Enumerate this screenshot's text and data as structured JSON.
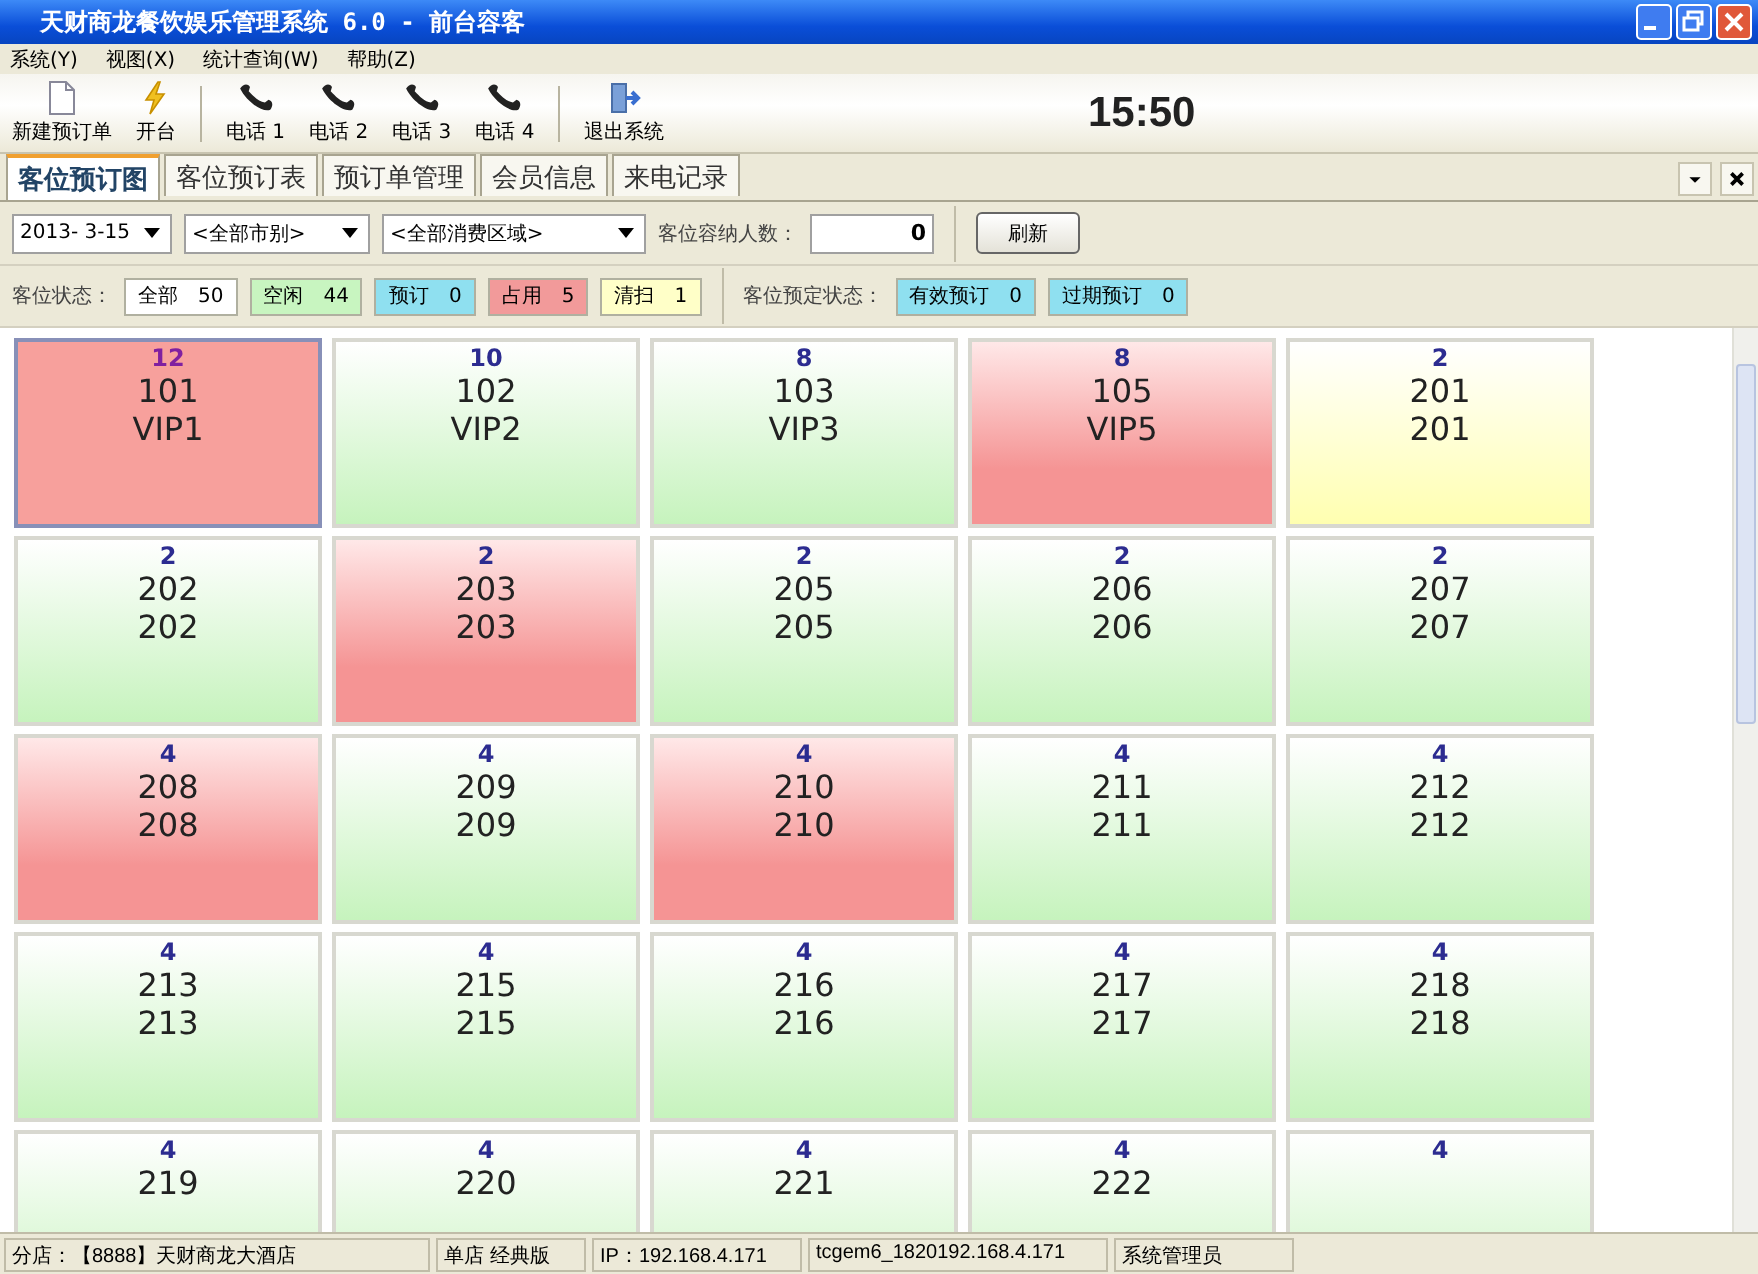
{
  "window": {
    "title": "天财商龙餐饮娱乐管理系统 6.0 - 前台容客"
  },
  "menu": [
    "系统(Y)",
    "视图(X)",
    "统计查询(W)",
    "帮助(Z)"
  ],
  "toolbar": [
    {
      "kind": "new",
      "label": "新建预订单"
    },
    {
      "kind": "open",
      "label": "开台"
    },
    {
      "kind": "separator"
    },
    {
      "kind": "phone",
      "label": "电话 1"
    },
    {
      "kind": "phone",
      "label": "电话 2"
    },
    {
      "kind": "phone",
      "label": "电话 3"
    },
    {
      "kind": "phone",
      "label": "电话 4"
    },
    {
      "kind": "separator"
    },
    {
      "kind": "exit",
      "label": "退出系统"
    }
  ],
  "clock": "15:50",
  "tabs": [
    {
      "label": "客位预订图",
      "selected": true
    },
    {
      "label": "客位预订表",
      "selected": false
    },
    {
      "label": "预订单管理",
      "selected": false
    },
    {
      "label": "会员信息",
      "selected": false
    },
    {
      "label": "来电记录",
      "selected": false
    }
  ],
  "filters": {
    "date": "2013- 3-15",
    "market": "<全部市别>",
    "area": "<全部消费区域>",
    "capacity_label": "客位容纳人数：",
    "capacity": "0",
    "refresh": "刷新"
  },
  "status_label": "客位状态：",
  "status_chips": [
    {
      "label": "全部",
      "count": "50",
      "color": "#ffffff"
    },
    {
      "label": "空闲",
      "count": "44",
      "color": "#c8f5c0"
    },
    {
      "label": "预订",
      "count": "0",
      "color": "#8fe0f0"
    },
    {
      "label": "占用",
      "count": "5",
      "color": "#f29a9a"
    },
    {
      "label": "清扫",
      "count": "1",
      "color": "#ffffc8"
    }
  ],
  "booking_label": "客位预定状态：",
  "booking_chips": [
    {
      "label": "有效预订",
      "count": "0",
      "color": "#8fe0f0"
    },
    {
      "label": "过期预订",
      "count": "0",
      "color": "#8fe0f0"
    }
  ],
  "tiles": [
    {
      "capacity": "12",
      "code": "101",
      "name": "VIP1",
      "kind": "occupied",
      "selected": true
    },
    {
      "capacity": "10",
      "code": "102",
      "name": "VIP2",
      "kind": "free",
      "selected": false
    },
    {
      "capacity": "8",
      "code": "103",
      "name": "VIP3",
      "kind": "free",
      "selected": false
    },
    {
      "capacity": "8",
      "code": "105",
      "name": "VIP5",
      "kind": "occupied",
      "selected": false
    },
    {
      "capacity": "2",
      "code": "201",
      "name": "201",
      "kind": "cleaning",
      "selected": false
    },
    {
      "capacity": "2",
      "code": "202",
      "name": "202",
      "kind": "free",
      "selected": false
    },
    {
      "capacity": "2",
      "code": "203",
      "name": "203",
      "kind": "occupied",
      "selected": false
    },
    {
      "capacity": "2",
      "code": "205",
      "name": "205",
      "kind": "free",
      "selected": false
    },
    {
      "capacity": "2",
      "code": "206",
      "name": "206",
      "kind": "free",
      "selected": false
    },
    {
      "capacity": "2",
      "code": "207",
      "name": "207",
      "kind": "free",
      "selected": false
    },
    {
      "capacity": "4",
      "code": "208",
      "name": "208",
      "kind": "occupied",
      "selected": false
    },
    {
      "capacity": "4",
      "code": "209",
      "name": "209",
      "kind": "free",
      "selected": false
    },
    {
      "capacity": "4",
      "code": "210",
      "name": "210",
      "kind": "occupied",
      "selected": false
    },
    {
      "capacity": "4",
      "code": "211",
      "name": "211",
      "kind": "free",
      "selected": false
    },
    {
      "capacity": "4",
      "code": "212",
      "name": "212",
      "kind": "free",
      "selected": false
    },
    {
      "capacity": "4",
      "code": "213",
      "name": "213",
      "kind": "free",
      "selected": false
    },
    {
      "capacity": "4",
      "code": "215",
      "name": "215",
      "kind": "free",
      "selected": false
    },
    {
      "capacity": "4",
      "code": "216",
      "name": "216",
      "kind": "free",
      "selected": false
    },
    {
      "capacity": "4",
      "code": "217",
      "name": "217",
      "kind": "free",
      "selected": false
    },
    {
      "capacity": "4",
      "code": "218",
      "name": "218",
      "kind": "free",
      "selected": false
    },
    {
      "capacity": "4",
      "code": "219",
      "kind": "free",
      "selected": false
    },
    {
      "capacity": "4",
      "code": "220",
      "kind": "free",
      "selected": false
    },
    {
      "capacity": "4",
      "code": "221",
      "kind": "free",
      "selected": false
    },
    {
      "capacity": "4",
      "code": "222",
      "kind": "free",
      "selected": false
    },
    {
      "capacity": "4",
      "kind": "free",
      "selected": false
    }
  ],
  "status_bar": [
    "分店：【8888】天财商龙大酒店",
    "单店 经典版",
    "IP：192.168.4.171",
    "tcgem6_1820192.168.4.171",
    "系统管理员"
  ]
}
